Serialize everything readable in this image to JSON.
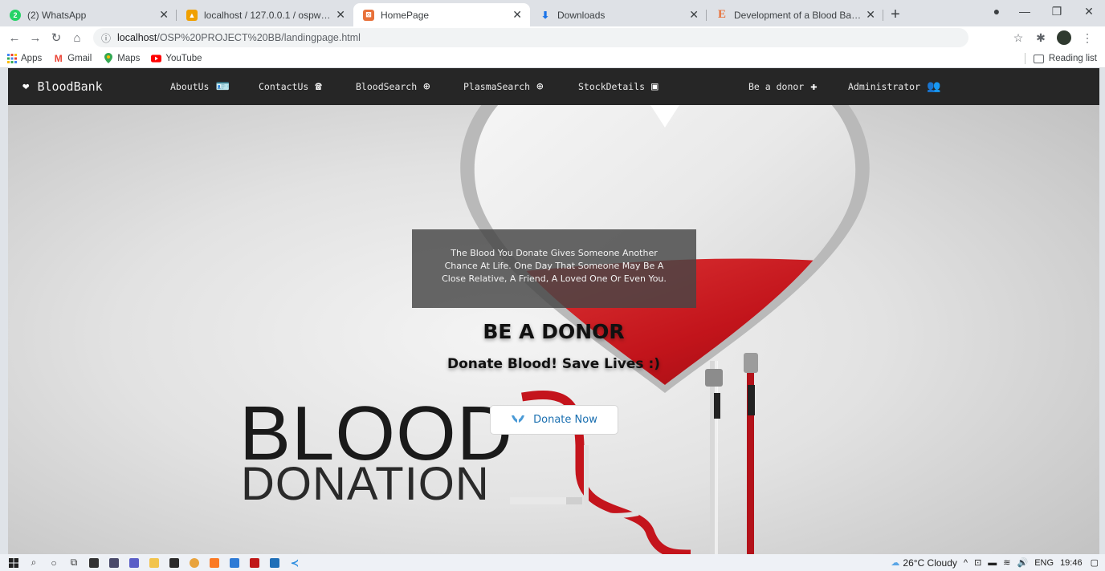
{
  "browser": {
    "tabs": [
      {
        "title": "(2) WhatsApp",
        "color": "#25d366",
        "glyph": "2",
        "active": false
      },
      {
        "title": "localhost / 127.0.0.1 / ospworks /",
        "color": "#f0a000",
        "glyph": "▲",
        "active": false
      },
      {
        "title": "HomePage",
        "color": "#e8713a",
        "glyph": "⊠",
        "active": true
      },
      {
        "title": "Downloads",
        "color": "#1a73e8",
        "glyph": "⬇",
        "active": false
      },
      {
        "title": "Development of a Blood Bank Ma",
        "color": "#e8713a",
        "glyph": "E",
        "active": false
      }
    ],
    "new_tab": "+",
    "window_controls": [
      "—",
      "❐",
      "✕"
    ],
    "url_host": "localhost",
    "url_path": "/OSP%20PROJECT%20BB/landingpage.html",
    "bookmarks": [
      {
        "label": "Apps",
        "icon": "apps-grid-icon"
      },
      {
        "label": "Gmail",
        "icon": "gmail-icon"
      },
      {
        "label": "Maps",
        "icon": "maps-pin-icon"
      },
      {
        "label": "YouTube",
        "icon": "youtube-icon"
      }
    ],
    "reading_list": "Reading list"
  },
  "navbar": {
    "brand": "BloodBank",
    "links": [
      {
        "label": "AboutUs",
        "icon": "id-card-icon"
      },
      {
        "label": "ContactUs",
        "icon": "phone-icon"
      },
      {
        "label": "BloodSearch",
        "icon": "search-plus-icon"
      },
      {
        "label": "PlasmaSearch",
        "icon": "search-plus-icon"
      },
      {
        "label": "StockDetails",
        "icon": "box-icon"
      },
      {
        "label": "Be a donor",
        "icon": "donor-icon"
      },
      {
        "label": "Administrator",
        "icon": "users-lock-icon"
      }
    ]
  },
  "hero": {
    "quote_line1": "The Blood You Donate Gives Someone Another",
    "quote_line2": "Chance At Life. One Day That Someone May Be A",
    "quote_line3": "Close Relative, A Friend, A Loved One Or Even You.",
    "title": "BE A DONOR",
    "subtitle": "Donate Blood! Save Lives :)",
    "button": "Donate Now",
    "art_word1": "BLOOD",
    "art_word2": "DONATION"
  },
  "taskbar": {
    "weather": "26°C Cloudy",
    "language": "ENG",
    "time": "19:46"
  },
  "colors": {
    "navbar_bg": "#262626",
    "blood_red": "#c4141c",
    "button_text": "#1a6fb0"
  }
}
